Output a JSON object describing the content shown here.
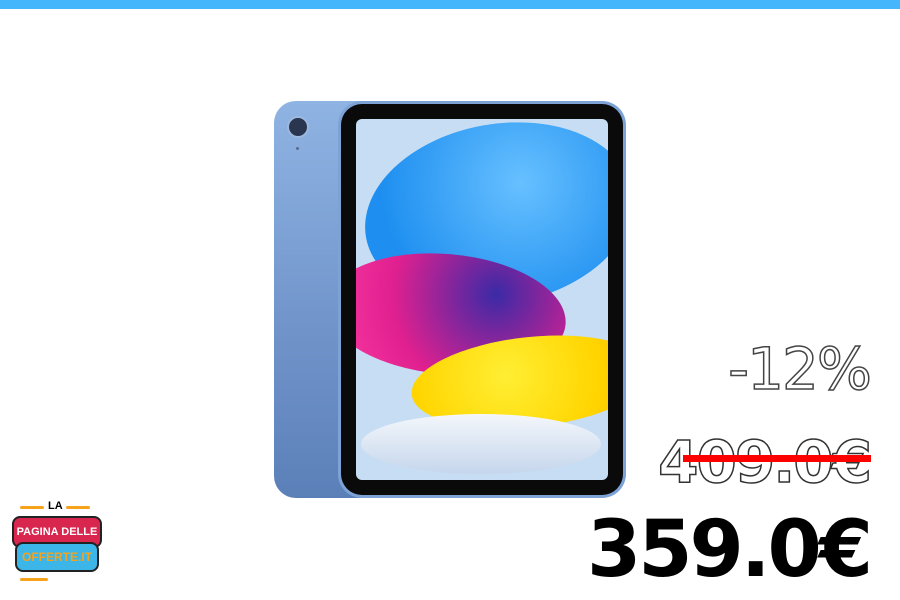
{
  "product": {
    "image_alt": "iPad blue"
  },
  "pricing": {
    "discount": "-12%",
    "old_price": "409.0€",
    "new_price": "359.0€"
  },
  "logo": {
    "line1": "LA",
    "line2": "PAGINA DELLE",
    "line3": "OFFERTE.IT"
  },
  "colors": {
    "top_bar": "#45b6fb",
    "strike": "#ff0000"
  }
}
